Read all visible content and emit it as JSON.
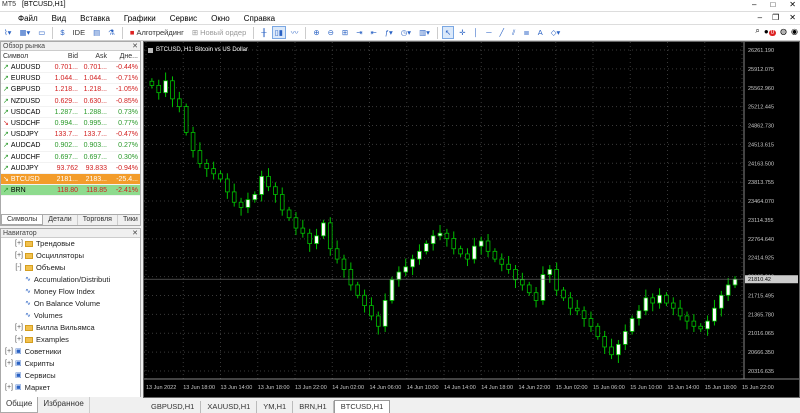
{
  "titlebar": {
    "app": "MT5",
    "title": "[BTCUSD,H1]"
  },
  "menu": [
    "Файл",
    "Вид",
    "Вставка",
    "Графики",
    "Сервис",
    "Окно",
    "Справка"
  ],
  "toolbar": {
    "ide": "IDE",
    "algo": "Алготрейдинг",
    "new_order": "Новый ордер",
    "notif": "0"
  },
  "market_watch": {
    "title": "Обзор рынка",
    "headers": [
      "Символ",
      "Bid",
      "Ask",
      "Дне..."
    ],
    "rows": [
      {
        "s": "AUDUSD",
        "bid": "0.701...",
        "ask": "0.701...",
        "chg": "-0.44%",
        "dir": "up"
      },
      {
        "s": "EURUSD",
        "bid": "1.044...",
        "ask": "1.044...",
        "chg": "-0.71%",
        "dir": "up"
      },
      {
        "s": "GBPUSD",
        "bid": "1.218...",
        "ask": "1.218...",
        "chg": "-1.05%",
        "dir": "up"
      },
      {
        "s": "NZDUSD",
        "bid": "0.629...",
        "ask": "0.630...",
        "chg": "-0.85%",
        "dir": "up"
      },
      {
        "s": "USDCAD",
        "bid": "1.287...",
        "ask": "1.288...",
        "chg": "0.73%",
        "dir": "up"
      },
      {
        "s": "USDCHF",
        "bid": "0.994...",
        "ask": "0.995...",
        "chg": "0.77%",
        "dir": "dn"
      },
      {
        "s": "USDJPY",
        "bid": "133.7...",
        "ask": "133.7...",
        "chg": "-0.47%",
        "dir": "up"
      },
      {
        "s": "AUDCAD",
        "bid": "0.902...",
        "ask": "0.903...",
        "chg": "0.27%",
        "dir": "up"
      },
      {
        "s": "AUDCHF",
        "bid": "0.697...",
        "ask": "0.697...",
        "chg": "0.30%",
        "dir": "up"
      },
      {
        "s": "AUDJPY",
        "bid": "93.762",
        "ask": "93.833",
        "chg": "-0.94%",
        "dir": "up"
      },
      {
        "s": "BTCUSD",
        "bid": "2181...",
        "ask": "2183...",
        "chg": "-25.4...",
        "dir": "dn",
        "hl": "btc"
      },
      {
        "s": "BRN",
        "bid": "118.80",
        "ask": "118.85",
        "chg": "-2.41%",
        "dir": "up",
        "hl": "brn"
      }
    ],
    "tabs": [
      "Символы",
      "Детали",
      "Торговля",
      "Тики"
    ]
  },
  "navigator": {
    "title": "Навигатор",
    "items": [
      {
        "t": "Трендовые",
        "lvl": 1,
        "kind": "folder",
        "pm": "+"
      },
      {
        "t": "Осцилляторы",
        "lvl": 1,
        "kind": "folder",
        "pm": "+"
      },
      {
        "t": "Объемы",
        "lvl": 1,
        "kind": "folder",
        "pm": "-"
      },
      {
        "t": "Accumulation/Distributi",
        "lvl": 2,
        "kind": "ind"
      },
      {
        "t": "Money Flow Index",
        "lvl": 2,
        "kind": "ind"
      },
      {
        "t": "On Balance Volume",
        "lvl": 2,
        "kind": "ind"
      },
      {
        "t": "Volumes",
        "lvl": 2,
        "kind": "ind"
      },
      {
        "t": "Билла Вильямса",
        "lvl": 1,
        "kind": "folder",
        "pm": "+"
      },
      {
        "t": "Examples",
        "lvl": 1,
        "kind": "folder",
        "pm": "+"
      },
      {
        "t": "Советники",
        "lvl": 0,
        "kind": "root",
        "pm": "+"
      },
      {
        "t": "Скрипты",
        "lvl": 0,
        "kind": "root",
        "pm": "+"
      },
      {
        "t": "Сервисы",
        "lvl": 0,
        "kind": "root",
        "pm": ""
      },
      {
        "t": "Маркет",
        "lvl": 0,
        "kind": "root",
        "pm": "+"
      }
    ],
    "tabs": [
      "Общие",
      "Избранное"
    ]
  },
  "chart": {
    "title": "BTCUSD, H1:  Bitcoin vs US Dollar",
    "current_price": "21810.42"
  },
  "chart_data": {
    "type": "candlestick",
    "title": "BTCUSD, H1:  Bitcoin vs US Dollar",
    "ylim": [
      19880,
      26400
    ],
    "y_ticks": [
      "26261.190",
      "25912.075",
      "25562.960",
      "25212.445",
      "24862.730",
      "24513.615",
      "24163.500",
      "23813.755",
      "23464.070",
      "23114.355",
      "22764.640",
      "22414.925",
      "22065.210",
      "21715.495",
      "21365.780",
      "21016.065",
      "20666.350",
      "20316.635"
    ],
    "x_ticks": [
      "13 Jun 2022",
      "13 Jun 18:00",
      "13 Jun 14:00",
      "13 Jun 18:00",
      "13 Jun 22:00",
      "14 Jun 02:00",
      "14 Jun 06:00",
      "14 Jun 10:00",
      "14 Jun 14:00",
      "14 Jun 18:00",
      "14 Jun 22:00",
      "15 Jun 02:00",
      "15 Jun 06:00",
      "15 Jun 10:00",
      "15 Jun 14:00",
      "15 Jun 18:00",
      "15 Jun 22:00"
    ],
    "colors": {
      "up": "#ffffff",
      "down": "#000000",
      "wick": "#00c000",
      "grid": "#3a3a3a",
      "axis": "#c8c8c8"
    },
    "close_series": [
      25560,
      25420,
      25650,
      25300,
      25150,
      24650,
      24300,
      24050,
      23950,
      23850,
      23750,
      23500,
      23300,
      23200,
      23350,
      23450,
      23800,
      23600,
      23450,
      23150,
      23000,
      22800,
      22700,
      22500,
      22650,
      22900,
      22400,
      22200,
      22000,
      21700,
      21500,
      21300,
      21100,
      20900,
      21400,
      21800,
      21950,
      22050,
      22200,
      22350,
      22500,
      22650,
      22700,
      22600,
      22400,
      22300,
      22200,
      22450,
      22550,
      22350,
      22200,
      22100,
      22000,
      21800,
      21700,
      21550,
      21400,
      21900,
      22000,
      21600,
      21450,
      21250,
      21200,
      21050,
      20900,
      20700,
      20500,
      20350,
      20550,
      20800,
      21050,
      21200,
      21450,
      21350,
      21500,
      21350,
      21250,
      21100,
      21000,
      20900,
      20850,
      21000,
      21250,
      21500,
      21700,
      21810
    ]
  },
  "bottom_tabs": [
    "GBPUSD,H1",
    "XAUUSD,H1",
    "YM,H1",
    "BRN,H1",
    "BTCUSD,H1"
  ]
}
